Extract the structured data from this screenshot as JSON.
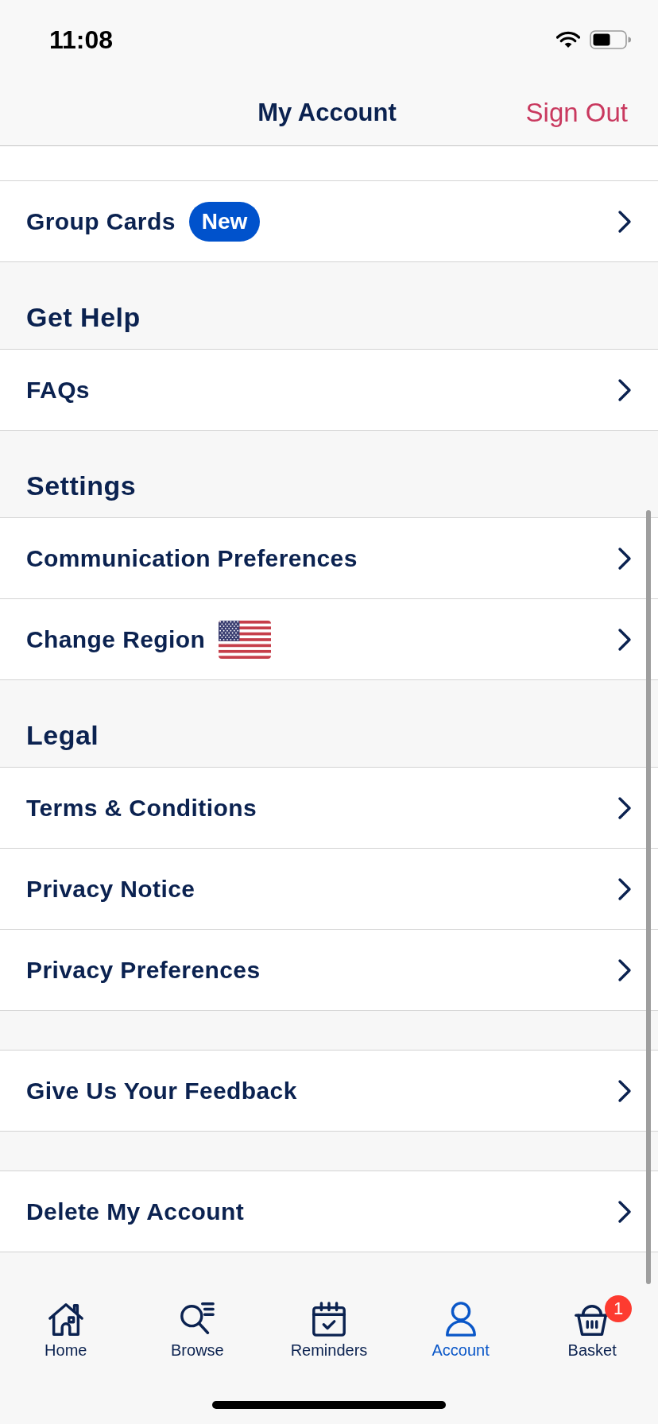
{
  "status_bar": {
    "time": "11:08"
  },
  "header": {
    "title": "My Account",
    "action": "Sign Out"
  },
  "sections": [
    {
      "rows": [
        {
          "kind": "badge",
          "label": "Group Cards",
          "badge": "New"
        }
      ]
    },
    {
      "heading": "Get Help",
      "rows": [
        {
          "kind": "plain",
          "label": "FAQs"
        }
      ]
    },
    {
      "heading": "Settings",
      "rows": [
        {
          "kind": "plain",
          "label": "Communication Preferences"
        },
        {
          "kind": "flag",
          "label": "Change Region"
        }
      ]
    },
    {
      "heading": "Legal",
      "rows": [
        {
          "kind": "plain",
          "label": "Terms & Conditions"
        },
        {
          "kind": "plain",
          "label": "Privacy Notice"
        },
        {
          "kind": "plain",
          "label": "Privacy Preferences"
        }
      ]
    },
    {
      "rows": [
        {
          "kind": "plain",
          "label": "Give Us Your Feedback"
        }
      ]
    },
    {
      "rows": [
        {
          "kind": "plain",
          "label": "Delete My Account"
        }
      ]
    }
  ],
  "tabs": [
    {
      "label": "Home",
      "selected": false
    },
    {
      "label": "Browse",
      "selected": false
    },
    {
      "label": "Reminders",
      "selected": false
    },
    {
      "label": "Account",
      "selected": true
    },
    {
      "label": "Basket",
      "selected": false,
      "badge": "1"
    }
  ]
}
